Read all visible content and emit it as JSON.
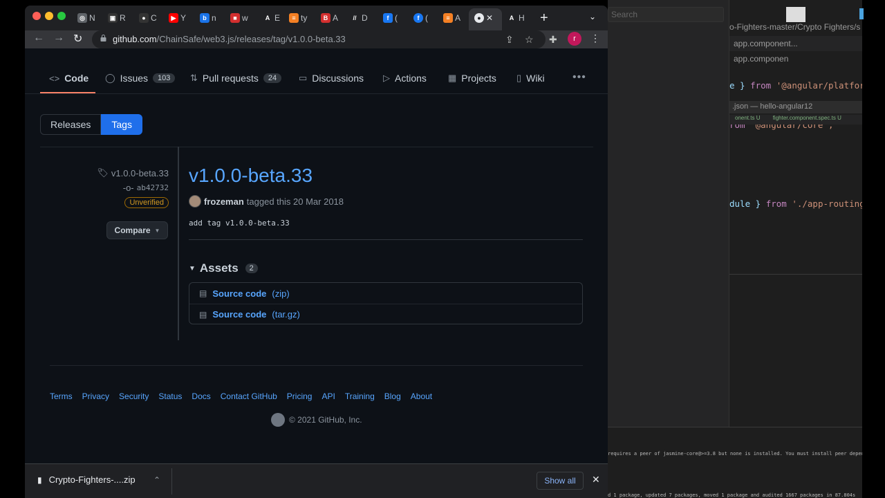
{
  "editor": {
    "search_placeholder": "Search",
    "path": "o-Fighters-master/Crypto Fighters/s",
    "tabs": [
      "app.component...",
      "app.componen"
    ],
    "code_lines": [
      {
        "a": "e } ",
        "k": "from",
        "s": " '@angular/platfor"
      },
      {
        "a": "",
        "k": "rom",
        "s": " '@angular/core';"
      },
      {
        "a": "",
        "k": "",
        "s": ""
      },
      {
        "a": "dule } ",
        "k": "from",
        "s": " './app-routing"
      }
    ],
    "file_title": ".json — hello-angular12",
    "file_tabs": [
      "onent.ts U",
      "fighter.component.spec.ts U"
    ],
    "terminal_line1": "requires a peer of jasmine-core@>=3.8 but none is installed. You must install peer dependencies yoursel",
    "terminal_line2": "d 1 package, updated 7 packages, moved 1 package and audited 1667 packages in 87.804s"
  },
  "browser": {
    "tabs": [
      {
        "icon": "chrome-icon",
        "label": "N",
        "color": "#5f6368",
        "glyph": "◎"
      },
      {
        "icon": "app-icon",
        "label": "R",
        "color": "#333",
        "glyph": "▣"
      },
      {
        "icon": "github-icon",
        "label": "C",
        "color": "#333",
        "glyph": "●"
      },
      {
        "icon": "youtube-icon",
        "label": "Y",
        "color": "#ff0000",
        "glyph": "▶"
      },
      {
        "icon": "bing-icon",
        "label": "n",
        "color": "#1a73e8",
        "glyph": "b"
      },
      {
        "icon": "news-icon",
        "label": "w",
        "color": "#d32f2f",
        "glyph": "■"
      },
      {
        "icon": "font-icon",
        "label": "E",
        "color": "#202124",
        "glyph": "A"
      },
      {
        "icon": "stack-icon",
        "label": "ty",
        "color": "#f48024",
        "glyph": "≡"
      },
      {
        "icon": "b-icon",
        "label": "A",
        "color": "#d32f2f",
        "glyph": "B"
      },
      {
        "icon": "slash-icon",
        "label": "D",
        "color": "#202124",
        "glyph": "//"
      },
      {
        "icon": "facebook-icon",
        "label": "(",
        "color": "#1877f2",
        "glyph": "f"
      }
    ],
    "active_tab_label": "(",
    "tab_after_1_label": "A",
    "tab_after_2_label": "H",
    "url_host": "github.com",
    "url_path": "/ChainSafe/web3.js/releases/tag/v1.0.0-beta.33",
    "profile_initial": "r"
  },
  "repo_nav": [
    {
      "icon": "code-icon",
      "glyph": "<>",
      "label": "Code",
      "count": ""
    },
    {
      "icon": "issue-icon",
      "glyph": "◯",
      "label": "Issues",
      "count": "103"
    },
    {
      "icon": "pull-request-icon",
      "glyph": "⇅",
      "label": "Pull requests",
      "count": "24"
    },
    {
      "icon": "discussion-icon",
      "glyph": "▭",
      "label": "Discussions",
      "count": ""
    },
    {
      "icon": "actions-icon",
      "glyph": "▷",
      "label": "Actions",
      "count": ""
    },
    {
      "icon": "projects-icon",
      "glyph": "▦",
      "label": "Projects",
      "count": ""
    },
    {
      "icon": "wiki-icon",
      "glyph": "▯",
      "label": "Wiki",
      "count": ""
    }
  ],
  "segments": {
    "releases": "Releases",
    "tags": "Tags"
  },
  "sidebar": {
    "tag": "v1.0.0-beta.33",
    "commit": "ab42732",
    "verification": "Unverified",
    "compare": "Compare"
  },
  "release": {
    "title": "v1.0.0-beta.33",
    "author": "frozeman",
    "tagged_text": "tagged this 20 Mar 2018",
    "message": "add tag v1.0.0-beta.33"
  },
  "assets": {
    "heading": "Assets",
    "count": "2",
    "items": [
      {
        "name": "Source code",
        "ext": "(zip)"
      },
      {
        "name": "Source code",
        "ext": "(tar.gz)"
      }
    ]
  },
  "footer": {
    "links": [
      "Terms",
      "Privacy",
      "Security",
      "Status",
      "Docs",
      "Contact GitHub",
      "Pricing",
      "API",
      "Training",
      "Blog",
      "About"
    ],
    "copyright": "© 2021 GitHub, Inc."
  },
  "downloads": {
    "file": "Crypto-Fighters-....zip",
    "show_all": "Show all"
  },
  "colors": {
    "accent_blue": "#58a6ff",
    "tab_underline": "#f78166",
    "tags_button": "#1f6feb",
    "unverified": "#d29922"
  }
}
